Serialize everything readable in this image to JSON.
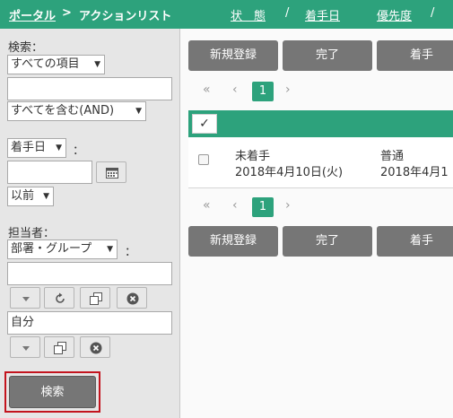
{
  "header": {
    "breadcrumb_link": "ポータル",
    "separator": ">",
    "title": "アクションリスト"
  },
  "sidebar": {
    "search_label": "検索：",
    "search_target": "すべての項目",
    "search_text": "",
    "match_mode": "すべてを含む(AND)",
    "date_field": "着手日",
    "colon": "：",
    "date_value": "",
    "date_mode": "以前",
    "assignee_label": "担当者：",
    "assignee_type": "部署・グループ",
    "assignee_text": "",
    "assignee_value": "自分",
    "search_button": "検索"
  },
  "toolbar": {
    "new_label": "新規登録",
    "done_label": "完了",
    "start_label": "着手"
  },
  "pagination": {
    "first": "«",
    "prev": "‹",
    "current": "1",
    "next": "›"
  },
  "table": {
    "check_all": "✓",
    "headers": [
      "状　態",
      "着手日",
      "優先度"
    ],
    "sep": "/",
    "rows": [
      {
        "status": "未着手",
        "start_date": "2018年4月10日(火)",
        "priority": "普通",
        "other": "2018年4月1"
      }
    ]
  },
  "colors": {
    "accent": "#2da27c",
    "button": "#767676",
    "highlight": "#c3141e"
  }
}
